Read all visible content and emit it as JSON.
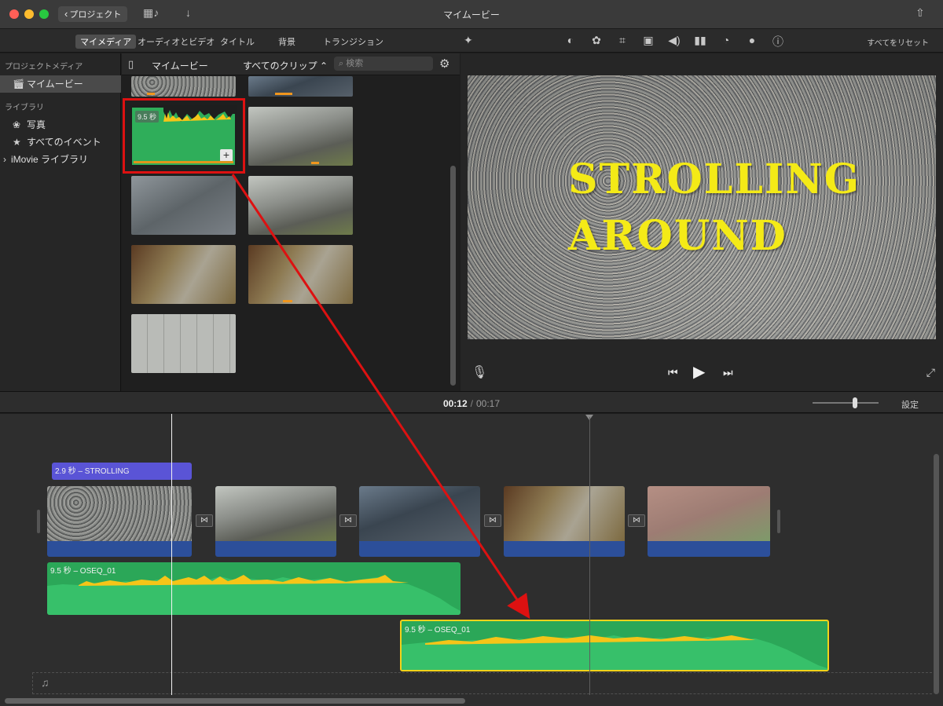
{
  "window": {
    "title": "マイムービー",
    "back_button": "プロジェクト"
  },
  "tabs": [
    "マイメディア",
    "オーディオとビデオ",
    "タイトル",
    "背景",
    "トランジション"
  ],
  "toolbar": {
    "reset_all": "すべてをリセット",
    "icons": [
      "color-balance-icon",
      "color-correction-icon",
      "crop-icon",
      "stabilization-icon",
      "volume-icon",
      "equalizer-icon",
      "speed-icon",
      "noise-reduction-icon",
      "info-icon"
    ]
  },
  "sidebar": {
    "project_media_heading": "プロジェクトメディア",
    "project_item": "マイムービー",
    "library_heading": "ライブラリ",
    "items": [
      "写真",
      "すべてのイベント",
      "iMovie ライブラリ"
    ]
  },
  "browser": {
    "title": "マイムービー",
    "filter": "すべてのクリップ",
    "search_placeholder": "検索",
    "audio_clip_duration": "9.5 秒"
  },
  "viewer": {
    "title_line1": "STROLLING",
    "title_line2": "AROUND"
  },
  "timeline": {
    "current_time": "00:12",
    "separator": "/",
    "total_time": "00:17",
    "settings_label": "設定",
    "zoom_level": 0.64,
    "title_clip_label": "2.9 秒 – STROLLING",
    "audio_clip_1_label": "9.5 秒 –  OSEQ_01",
    "audio_clip_2_label": "9.5 秒 –  OSEQ_01"
  },
  "colors": {
    "audio_green": "#2ba758",
    "waveform_peak": "#f5c518",
    "title_clip": "#5a54d6",
    "video_blue": "#2c4f9a",
    "highlight_red": "#dd1111",
    "overlay_text": "#f4ea17"
  }
}
